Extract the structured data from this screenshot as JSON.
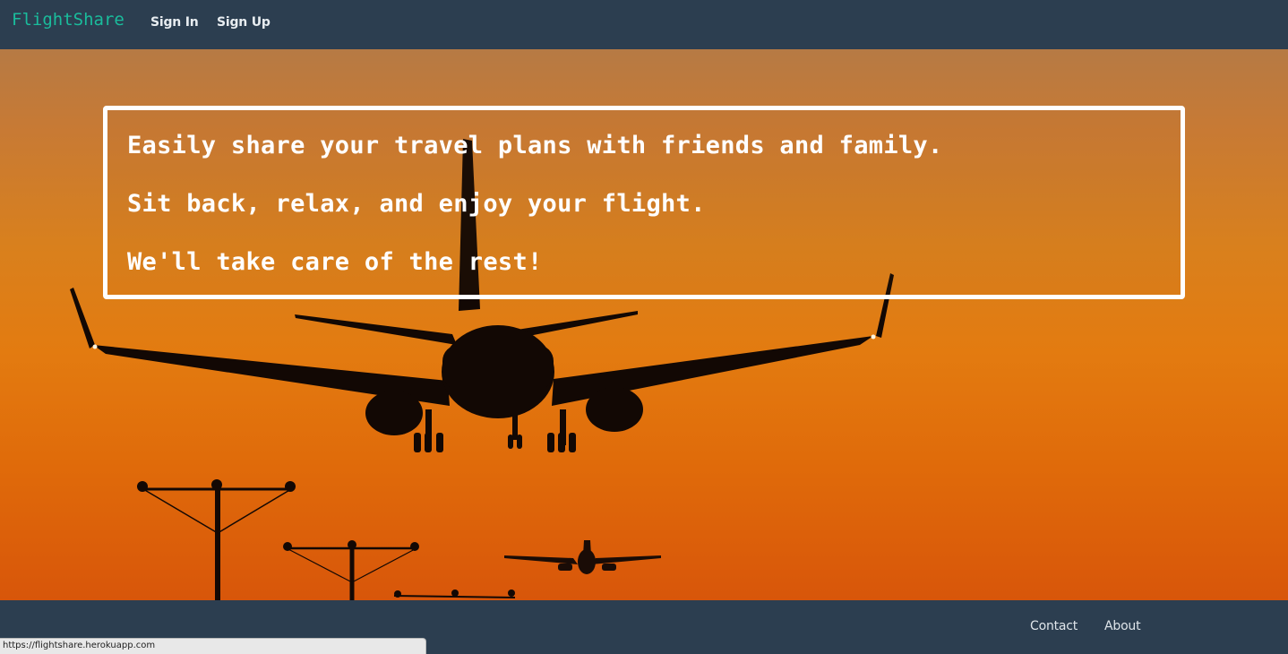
{
  "navbar": {
    "brand": "FlightShare",
    "links": [
      "Sign In",
      "Sign Up"
    ]
  },
  "hero": {
    "image": "airplane-landing-sunset",
    "taglines": [
      "Easily share your travel plans with friends and family.",
      "Sit back, relax, and enjoy your flight.",
      "We'll take care of the rest!"
    ]
  },
  "footer": {
    "links": [
      "Contact",
      "About"
    ]
  },
  "status_bar": {
    "url": "https://flightshare.herokuapp.com"
  },
  "colors": {
    "navbar_bg": "#2c3e50",
    "brand": "#1abc9c",
    "tagline_text": "#ffffff"
  }
}
